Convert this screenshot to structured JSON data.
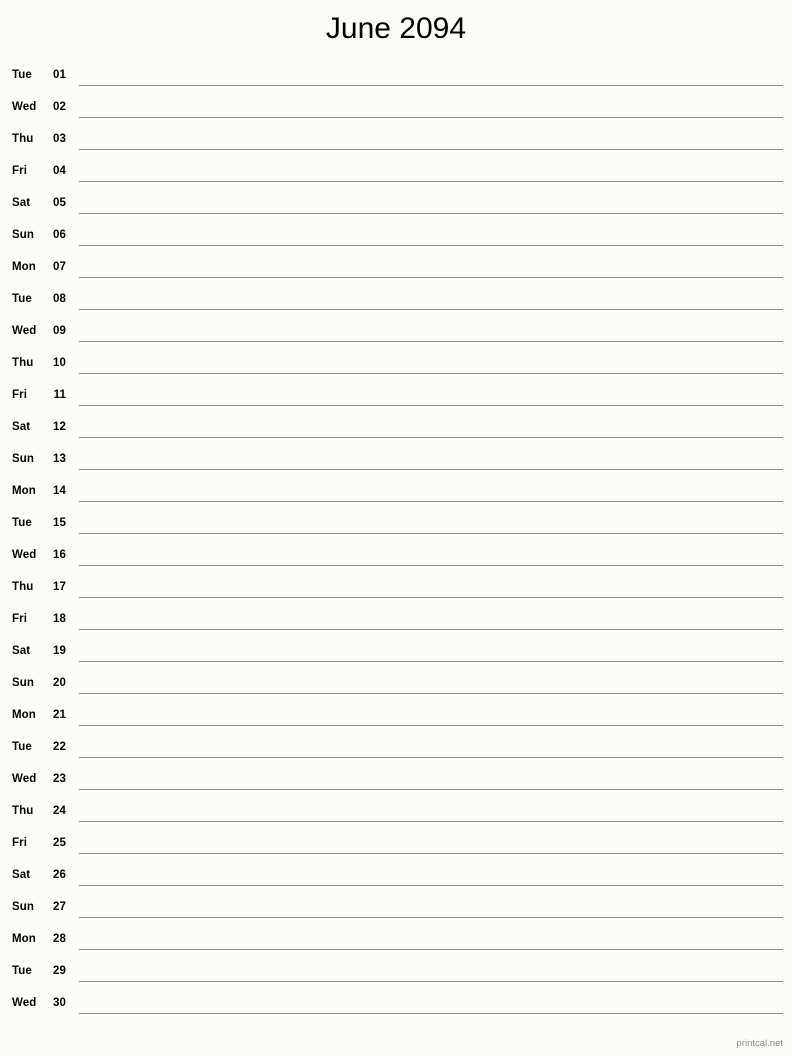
{
  "header": {
    "title": "June 2094"
  },
  "footer": {
    "credit": "printcal.net"
  },
  "style": {
    "background": "#fcfdf8",
    "text_color": "#000000",
    "rule_color": "#888d85",
    "footer_color": "#8a8a8a"
  },
  "calendar": {
    "month": "June",
    "year": "2094",
    "days": [
      {
        "weekday": "Tue",
        "date": "01"
      },
      {
        "weekday": "Wed",
        "date": "02"
      },
      {
        "weekday": "Thu",
        "date": "03"
      },
      {
        "weekday": "Fri",
        "date": "04"
      },
      {
        "weekday": "Sat",
        "date": "05"
      },
      {
        "weekday": "Sun",
        "date": "06"
      },
      {
        "weekday": "Mon",
        "date": "07"
      },
      {
        "weekday": "Tue",
        "date": "08"
      },
      {
        "weekday": "Wed",
        "date": "09"
      },
      {
        "weekday": "Thu",
        "date": "10"
      },
      {
        "weekday": "Fri",
        "date": "11"
      },
      {
        "weekday": "Sat",
        "date": "12"
      },
      {
        "weekday": "Sun",
        "date": "13"
      },
      {
        "weekday": "Mon",
        "date": "14"
      },
      {
        "weekday": "Tue",
        "date": "15"
      },
      {
        "weekday": "Wed",
        "date": "16"
      },
      {
        "weekday": "Thu",
        "date": "17"
      },
      {
        "weekday": "Fri",
        "date": "18"
      },
      {
        "weekday": "Sat",
        "date": "19"
      },
      {
        "weekday": "Sun",
        "date": "20"
      },
      {
        "weekday": "Mon",
        "date": "21"
      },
      {
        "weekday": "Tue",
        "date": "22"
      },
      {
        "weekday": "Wed",
        "date": "23"
      },
      {
        "weekday": "Thu",
        "date": "24"
      },
      {
        "weekday": "Fri",
        "date": "25"
      },
      {
        "weekday": "Sat",
        "date": "26"
      },
      {
        "weekday": "Sun",
        "date": "27"
      },
      {
        "weekday": "Mon",
        "date": "28"
      },
      {
        "weekday": "Tue",
        "date": "29"
      },
      {
        "weekday": "Wed",
        "date": "30"
      }
    ]
  }
}
